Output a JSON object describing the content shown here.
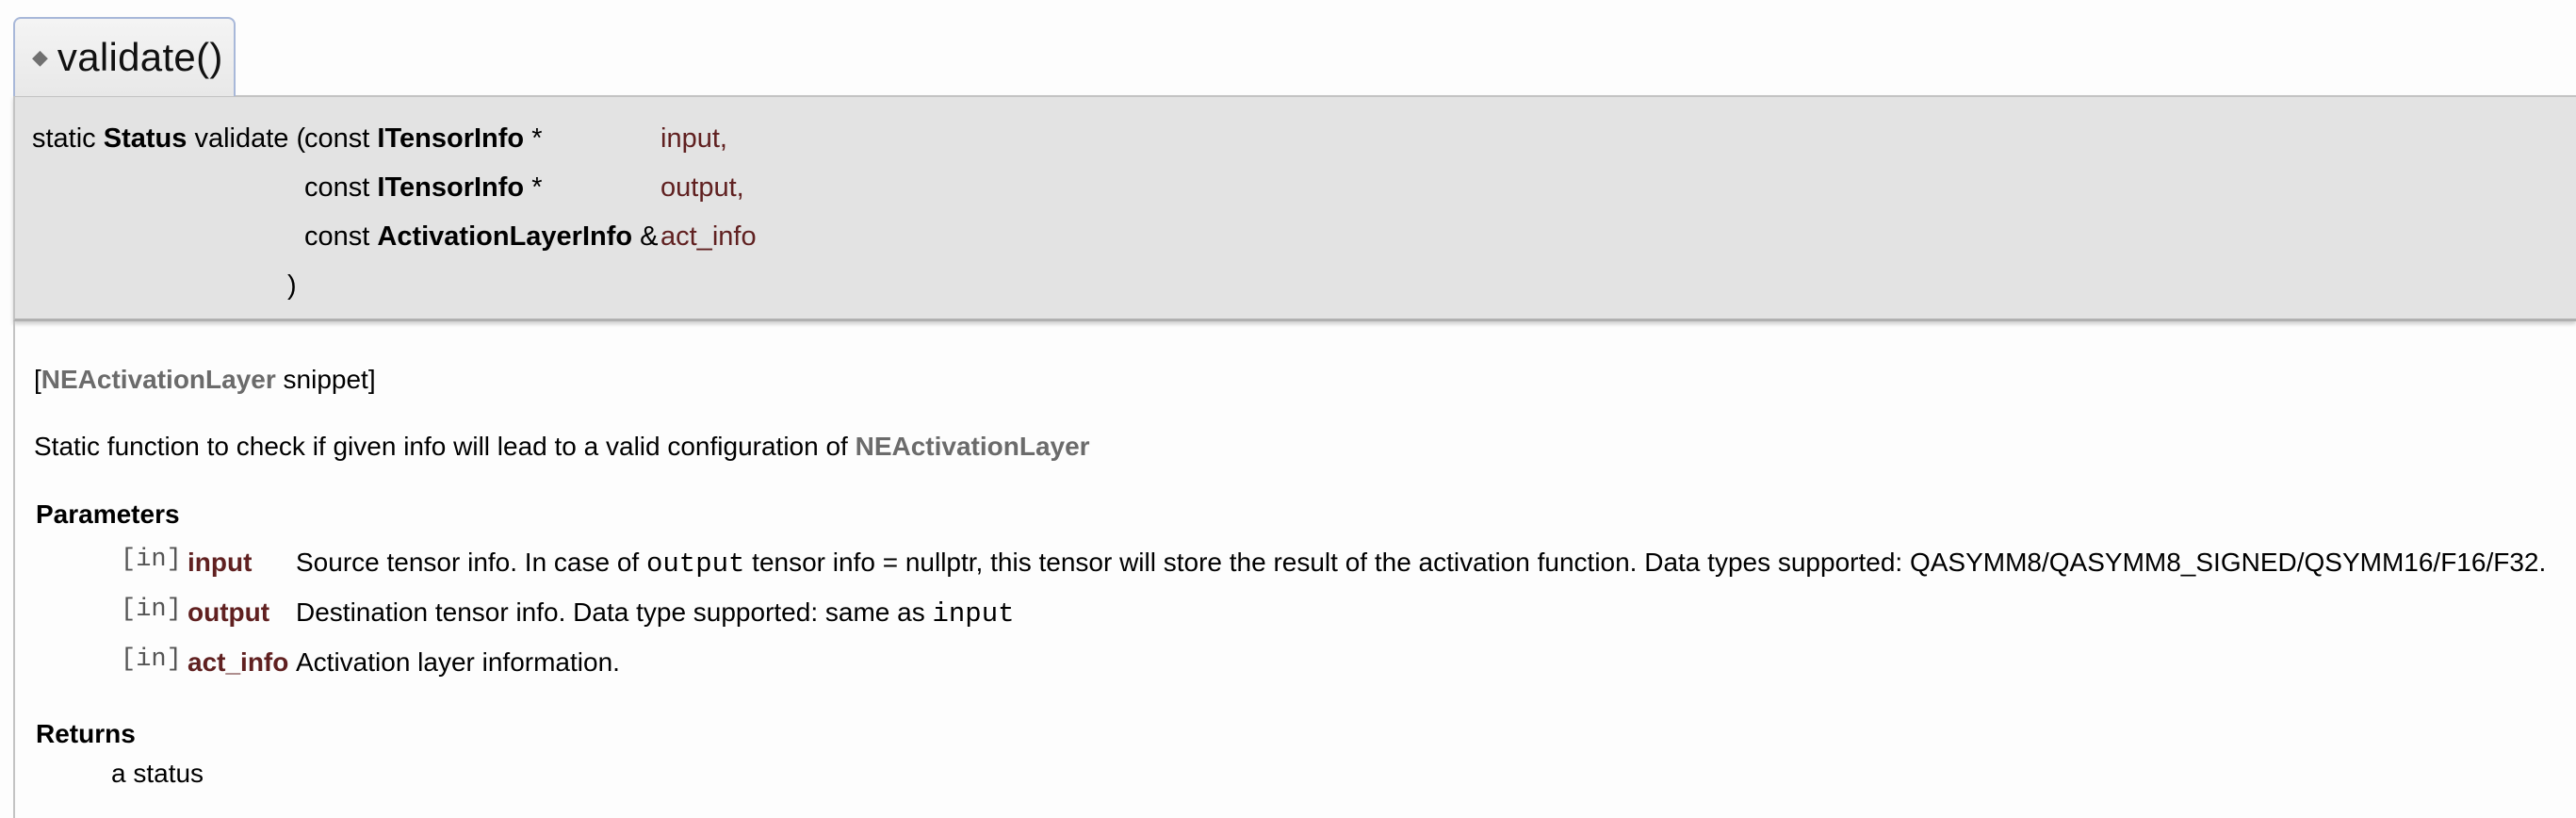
{
  "member": {
    "diamond_glyph": "◆",
    "name": "validate()"
  },
  "prototype": {
    "qualifier": "static",
    "return_type": "Status",
    "function_name": "validate",
    "open_paren": "(",
    "close_paren": ")",
    "params": [
      {
        "const": "const",
        "type": "ITensorInfo",
        "suffix": "*",
        "name": "input,"
      },
      {
        "const": "const",
        "type": "ITensorInfo",
        "suffix": "*",
        "name": "output,"
      },
      {
        "const": "const",
        "type": "ActivationLayerInfo",
        "suffix": "&",
        "name": "act_info"
      }
    ]
  },
  "doc": {
    "snippet": {
      "open": "[",
      "link": "NEActivationLayer",
      "rest": " snippet]"
    },
    "brief": {
      "text": "Static function to check if given info will lead to a valid configuration of ",
      "link": "NEActivationLayer"
    },
    "parameters_title": "Parameters",
    "parameters": [
      {
        "dir": "[in]",
        "name": "input",
        "desc_a": "Source tensor info. In case of ",
        "code": "output",
        "desc_b": " tensor info = nullptr, this tensor will store the result of the activation function. Data types supported: QASYMM8/QASYMM8_SIGNED/QSYMM16/F16/F32."
      },
      {
        "dir": "[in]",
        "name": "output",
        "desc_a": "Destination tensor info. Data type supported: same as ",
        "code": "input",
        "desc_b": ""
      },
      {
        "dir": "[in]",
        "name": "act_info",
        "desc_a": "Activation layer information.",
        "code": "",
        "desc_b": ""
      }
    ],
    "returns_title": "Returns",
    "returns_text": "a status"
  },
  "colors": {
    "param_name": "#602020",
    "link": "#6b6b6b",
    "proto_bg": "#e3e3e3",
    "tab_border": "#a8b8d9"
  }
}
